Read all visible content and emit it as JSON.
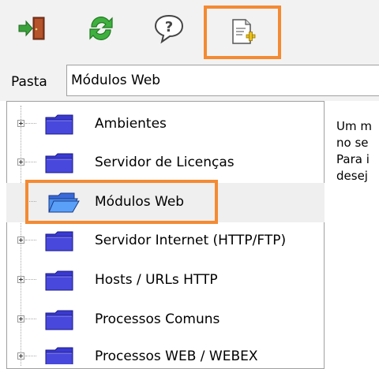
{
  "toolbar": {
    "buttons": [
      {
        "icon": "exit-door-icon"
      },
      {
        "icon": "refresh-icon"
      },
      {
        "icon": "help-icon"
      },
      {
        "icon": "new-document-icon",
        "highlighted": true
      }
    ]
  },
  "pasta": {
    "label": "Pasta",
    "value": "Módulos Web"
  },
  "tree": {
    "items": [
      {
        "label": "Ambientes",
        "expandable": true,
        "selected": false
      },
      {
        "label": "Servidor de Licenças",
        "expandable": true,
        "selected": false
      },
      {
        "label": "Módulos Web",
        "expandable": false,
        "selected": true,
        "open": true
      },
      {
        "label": "Servidor Internet (HTTP/FTP)",
        "expandable": true,
        "selected": false
      },
      {
        "label": "Hosts / URLs HTTP",
        "expandable": true,
        "selected": false
      },
      {
        "label": "Processos Comuns",
        "expandable": true,
        "selected": false
      },
      {
        "label": "Processos WEB / WEBEX",
        "expandable": true,
        "selected": false
      }
    ]
  },
  "description": {
    "lines": [
      "Um m",
      "no se",
      "Para i",
      "desej"
    ]
  },
  "colors": {
    "highlight": "#f58a32",
    "folder": "#3a3ad0",
    "selected_row": "#efefef"
  }
}
